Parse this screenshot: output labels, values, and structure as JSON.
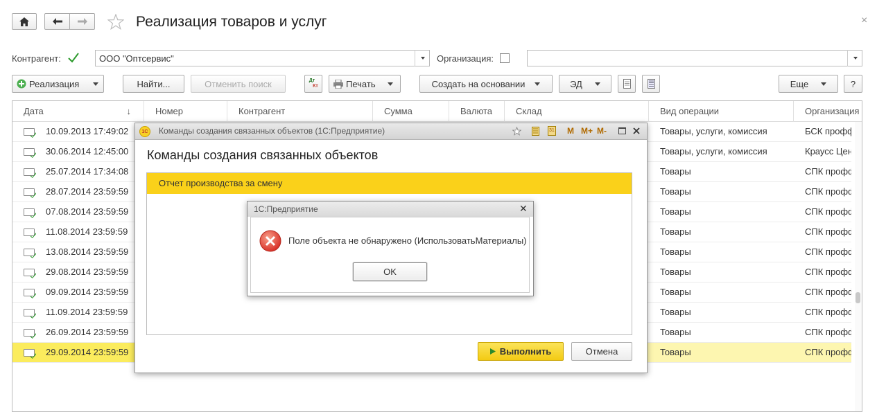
{
  "window": {
    "title": "Реализация товаров и услуг",
    "close_glyph": "×"
  },
  "filters": {
    "counterparty_label": "Контрагент:",
    "counterparty_value": "ООО \"Оптсервис\"",
    "organization_label": "Организация:",
    "organization_value": ""
  },
  "toolbar": {
    "realization": "Реализация",
    "find": "Найти...",
    "cancel_search": "Отменить поиск",
    "dt_kt_line1": "Дт",
    "dt_kt_line2": "Кт",
    "print": "Печать",
    "create_based_on": "Создать на основании",
    "ed": "ЭД",
    "more": "Еще",
    "help": "?"
  },
  "table": {
    "columns": [
      "Дата",
      "Номер",
      "Контрагент",
      "Сумма",
      "Валюта",
      "Склад",
      "Вид операции",
      "Организация"
    ],
    "sort_glyph": "↓",
    "rows": [
      {
        "date": "10.09.2013 17:49:02",
        "operation": "Товары, услуги, комиссия",
        "org": "БСК профф"
      },
      {
        "date": "30.06.2014 12:45:00",
        "operation": "Товары, услуги, комиссия",
        "org": "Краусс Цент"
      },
      {
        "date": "25.07.2014 17:34:08",
        "operation": "Товары",
        "org": "СПК профф"
      },
      {
        "date": "28.07.2014 23:59:59",
        "operation": "Товары",
        "org": "СПК профф"
      },
      {
        "date": "07.08.2014 23:59:59",
        "operation": "Товары",
        "org": "СПК профф"
      },
      {
        "date": "11.08.2014 23:59:59",
        "operation": "Товары",
        "org": "СПК профф"
      },
      {
        "date": "13.08.2014 23:59:59",
        "operation": "Товары",
        "org": "СПК профф"
      },
      {
        "date": "29.08.2014 23:59:59",
        "operation": "Товары",
        "org": "СПК профф"
      },
      {
        "date": "09.09.2014 23:59:59",
        "operation": "Товары",
        "org": "СПК профф"
      },
      {
        "date": "11.09.2014 23:59:59",
        "operation": "Товары",
        "org": "СПК профф"
      },
      {
        "date": "26.09.2014 23:59:59",
        "operation": "Товары",
        "org": "СПК профф"
      },
      {
        "date": "29.09.2014 23:59:59",
        "operation": "Товары",
        "org": "СПК профф",
        "selected": true
      }
    ]
  },
  "dialog_commands": {
    "window_title": "Команды создания связанных объектов  (1С:Предприятие)",
    "app_badge": "1С",
    "heading": "Команды создания связанных объектов",
    "selected_item": "Отчет производства за смену",
    "title_icons": {
      "m": "M",
      "m_plus": "M+",
      "m_minus": "M-",
      "calendar_day": "31"
    },
    "execute_button": "Выполнить",
    "cancel_button": "Отмена"
  },
  "dialog_error": {
    "title": "1С:Предприятие",
    "message": "Поле объекта не обнаружено (ИспользоватьМатериалы)",
    "ok_button": "OK",
    "close_glyph": "✕"
  },
  "colors": {
    "selection_yellow": "#fbec5d",
    "highlight_yellow": "#fad11a",
    "execute_button": "#f6d41d",
    "error_red": "#d9322a",
    "check_green": "#2c9a2c"
  }
}
